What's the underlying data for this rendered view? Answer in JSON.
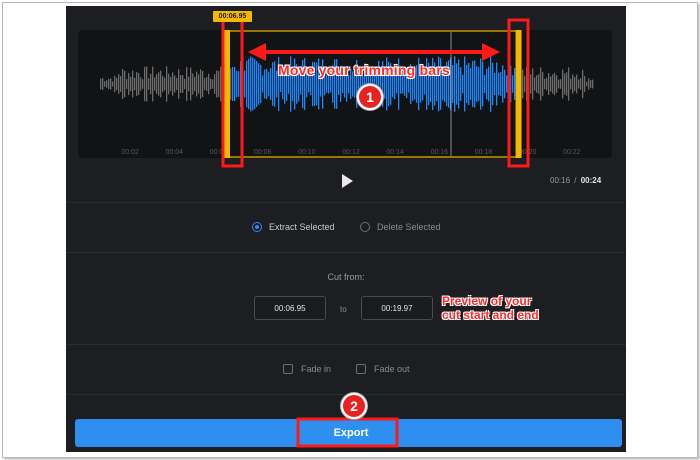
{
  "trimmer": {
    "handle_time_tag": "00:06.95",
    "timeline_ticks": [
      "00:02",
      "00:04",
      "00:06",
      "00:08",
      "00:10",
      "00:12",
      "00:14",
      "00:16",
      "00:18",
      "00:20",
      "00:22"
    ],
    "selection_start_fraction": 0.279,
    "selection_end_fraction": 0.825,
    "current_time": "00:16",
    "separator": "/",
    "total_time": "00:24"
  },
  "mode": {
    "extract_label": "Extract Selected",
    "delete_label": "Delete Selected",
    "selected": "extract"
  },
  "cut": {
    "label": "Cut from:",
    "start": "00:06.95",
    "to_label": "to",
    "end": "00:19.97"
  },
  "fades": {
    "fade_in_label": "Fade in",
    "fade_out_label": "Fade out"
  },
  "export": {
    "label": "Export"
  },
  "annotations": {
    "move_note": "Move your trimming bars",
    "preview_note_line1": "Preview of your",
    "preview_note_line2": "cut start and end",
    "badge_1": "1",
    "badge_2": "2"
  },
  "colors": {
    "app_bg": "#1d1e21",
    "wave_selected": "#1e88ff",
    "wave_unselected": "#6b6b6b",
    "handle": "#f5b800",
    "accent": "#2f8ff0",
    "annotation_red": "#ff2a2a"
  },
  "icons": {
    "play": "play-icon"
  }
}
